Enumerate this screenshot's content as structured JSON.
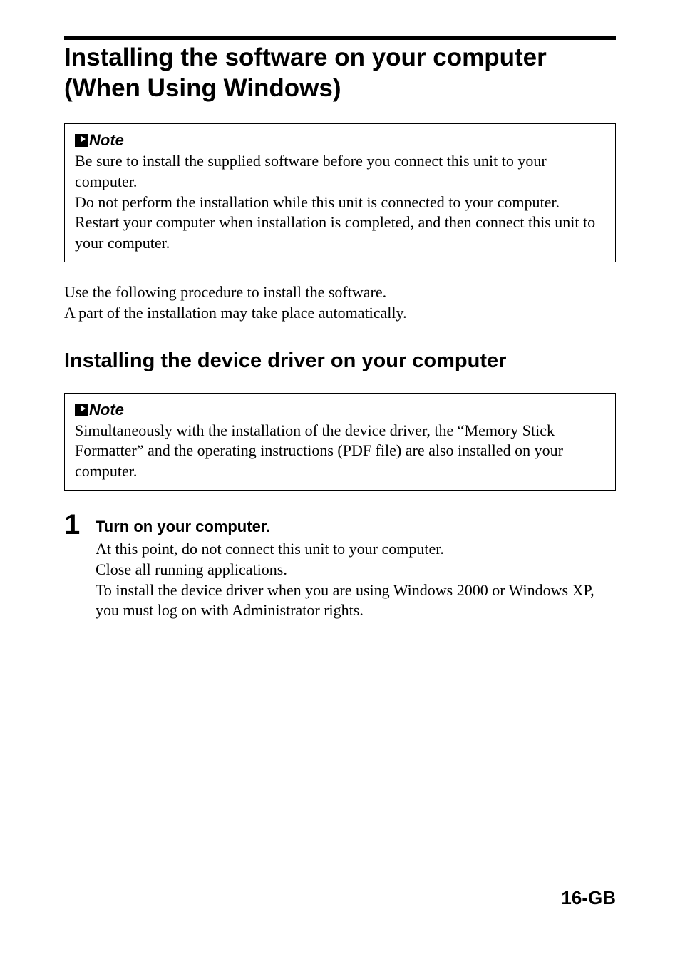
{
  "title": "Installing the software on your computer (When Using Windows)",
  "note1": {
    "label": "Note",
    "paragraphs": [
      "Be sure to install the supplied software before you connect this unit to your computer.",
      "Do not perform the installation while this unit is connected to your computer.",
      "Restart your computer when installation is completed, and then connect this unit to your computer."
    ]
  },
  "intro": {
    "paragraphs": [
      "Use the following procedure to install the software.",
      "A part of the installation may take place automatically."
    ]
  },
  "subtitle": "Installing the device driver on your computer",
  "note2": {
    "label": "Note",
    "paragraphs": [
      "Simultaneously with the installation of the device driver, the “Memory Stick Formatter” and the operating instructions (PDF file) are also installed on your computer."
    ]
  },
  "step1": {
    "number": "1",
    "heading": "Turn on your computer.",
    "paragraphs": [
      "At this point, do not connect this unit to your computer.",
      "Close all running applications.",
      "To install the device driver when you are using Windows 2000 or Windows XP, you must log on with Administrator rights."
    ]
  },
  "page_number": "16-GB"
}
